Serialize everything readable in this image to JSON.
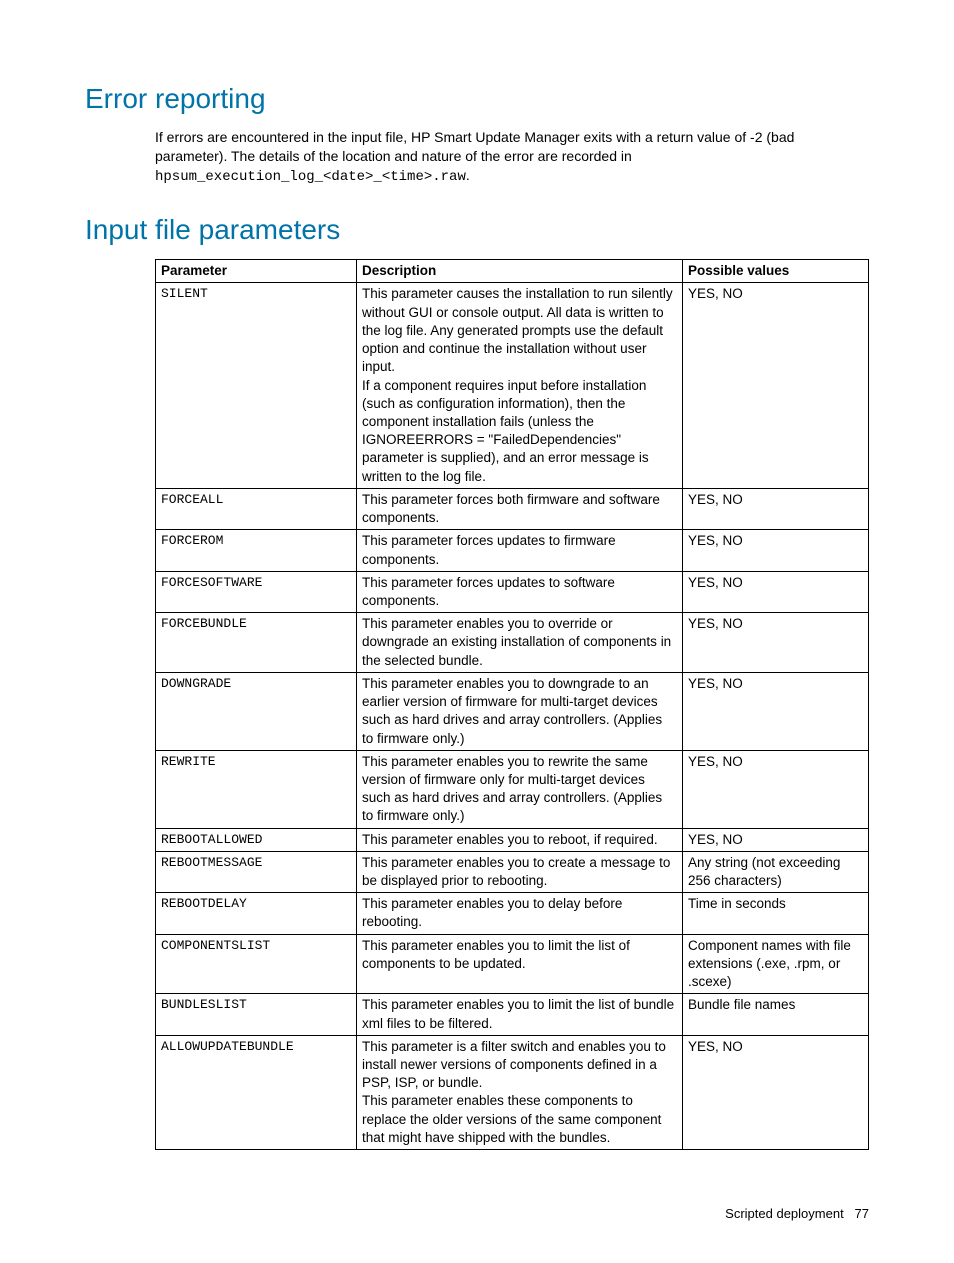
{
  "section1": {
    "title": "Error reporting",
    "para_pre": "If errors are encountered in the input file, HP Smart Update Manager exits with a return value of -2 (bad parameter). The details of the location and nature of the error are recorded in ",
    "code": "hpsum_execution_log_<date>_<time>.raw",
    "para_post": "."
  },
  "section2": {
    "title": "Input file parameters",
    "headers": {
      "param": "Parameter",
      "desc": "Description",
      "vals": "Possible values"
    },
    "rows": [
      {
        "param": "SILENT",
        "desc": [
          "This parameter causes the installation to run silently without GUI or console output. All data is written to the log file. Any generated prompts use the default option and continue the installation without user input.",
          "If a component requires input before installation (such as configuration information), then the component installation fails (unless the IGNOREERRORS = \"FailedDependencies\" parameter is supplied), and an error message is written to the log file."
        ],
        "vals": "YES, NO"
      },
      {
        "param": "FORCEALL",
        "desc": [
          "This parameter forces both firmware and software components."
        ],
        "vals": "YES, NO"
      },
      {
        "param": "FORCEROM",
        "desc": [
          "This parameter forces updates to firmware components."
        ],
        "vals": "YES, NO"
      },
      {
        "param": "FORCESOFTWARE",
        "desc": [
          "This parameter forces updates to software components."
        ],
        "vals": "YES, NO"
      },
      {
        "param": "FORCEBUNDLE",
        "desc": [
          "This parameter enables you to override or downgrade an existing installation of components in the selected bundle."
        ],
        "vals": "YES, NO"
      },
      {
        "param": "DOWNGRADE",
        "desc": [
          "This parameter enables you to downgrade to an earlier version of firmware for multi-target devices such as hard drives and array controllers. (Applies to firmware only.)"
        ],
        "vals": "YES, NO"
      },
      {
        "param": "REWRITE",
        "desc": [
          "This parameter enables you to rewrite the same version of firmware only for multi-target devices such as hard drives and array controllers. (Applies to firmware only.)"
        ],
        "vals": "YES, NO"
      },
      {
        "param": "REBOOTALLOWED",
        "desc": [
          "This parameter enables you to reboot, if required."
        ],
        "vals": "YES, NO"
      },
      {
        "param": "REBOOTMESSAGE",
        "desc": [
          "This parameter enables you to create a message to be displayed prior to rebooting."
        ],
        "vals": "Any string (not exceeding 256 characters)"
      },
      {
        "param": "REBOOTDELAY",
        "desc": [
          "This parameter enables you to delay before rebooting."
        ],
        "vals": "Time in seconds"
      },
      {
        "param": "COMPONENTSLIST",
        "desc": [
          "This parameter enables you to limit the list of components to be updated."
        ],
        "vals": "Component names with file extensions (.exe, .rpm, or .scexe)"
      },
      {
        "param": "BUNDLESLIST",
        "desc": [
          "This parameter enables you to limit the list of bundle xml files to be filtered."
        ],
        "vals": "Bundle file names"
      },
      {
        "param": "ALLOWUPDATEBUNDLE",
        "desc": [
          "This parameter is a filter switch and enables you to install newer versions of components defined in a PSP, ISP, or bundle.",
          "This parameter enables these components to replace the older versions of the same component that might have shipped with the bundles."
        ],
        "vals": "YES, NO"
      }
    ]
  },
  "footer": {
    "text": "Scripted deployment",
    "page": "77"
  }
}
